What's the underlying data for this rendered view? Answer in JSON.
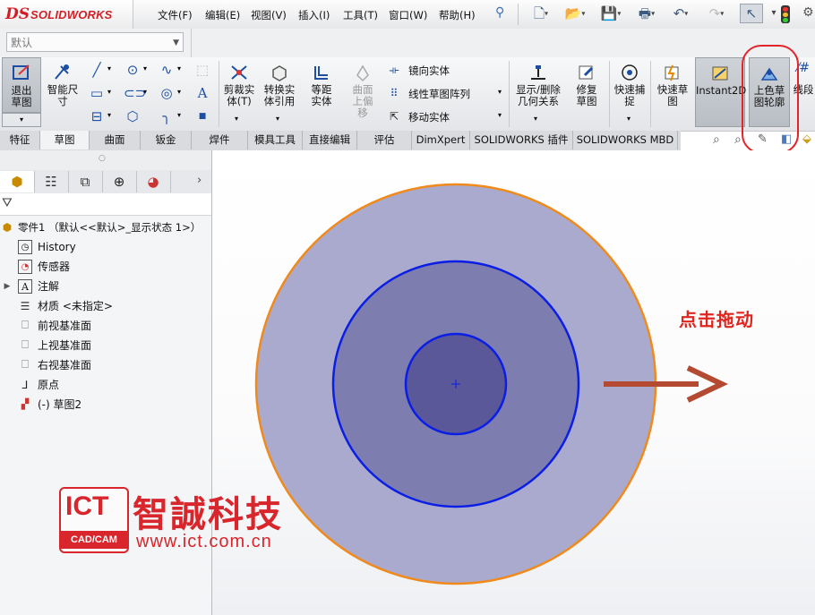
{
  "app": {
    "logo_ds": "DS",
    "logo_text": "SOLIDWORKS"
  },
  "menu": [
    "文件(F)",
    "编辑(E)",
    "视图(V)",
    "插入(I)",
    "工具(T)",
    "窗口(W)",
    "帮助(H)"
  ],
  "config": {
    "value": "默认"
  },
  "commands": {
    "exit_sketch": "退出草图",
    "smart_dim": "智能尺寸",
    "trim": "剪裁实体(T)",
    "convert": "转换实体引用",
    "offset": "等距实体",
    "offset_surface": "曲面上偏移",
    "mirror": "镜向实体",
    "linear_pattern": "线性草图阵列",
    "move": "移动实体",
    "display_relations": "显示/删除几何关系",
    "repair": "修复草图",
    "quick_snaps": "快速捕捉",
    "rapid_sketch": "快速草图",
    "instant2d": "Instant2D",
    "shaded_contours": "上色草图轮廓",
    "more": "线段"
  },
  "tabs": [
    "特征",
    "草图",
    "曲面",
    "钣金",
    "焊件",
    "模具工具",
    "直接编辑",
    "评估",
    "DimXpert",
    "SOLIDWORKS 插件",
    "SOLIDWORKS MBD"
  ],
  "active_tab": "草图",
  "tree": {
    "root": "零件1 （默认<<默认>_显示状态 1>）",
    "items": [
      "History",
      "传感器",
      "注解",
      "材质 <未指定>",
      "前视基准面",
      "上视基准面",
      "右视基准面",
      "原点",
      "(-) 草图2"
    ]
  },
  "annotation": {
    "drag_text": "点击拖动"
  },
  "watermark": {
    "ict": "ICT",
    "cadcam": "CAD/CAM",
    "name": "智誠科技",
    "url": "www.ict.com.cn"
  },
  "colors": {
    "accent": "#1c4fa3",
    "highlight": "#d8262c",
    "circle_fill": "#a9a9cf",
    "circle_edge": "#f08a1c",
    "sketch_blue": "#0a1ee6",
    "arrow": "#b54a32"
  }
}
